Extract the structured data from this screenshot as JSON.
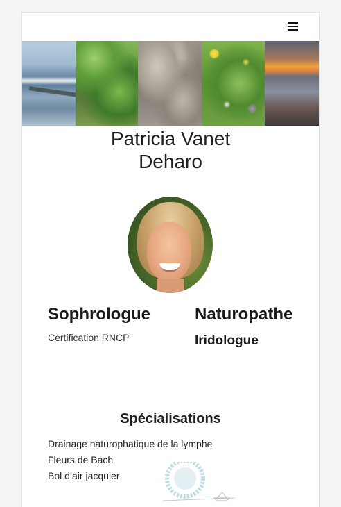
{
  "header": {
    "menu_icon": "hamburger-menu-icon"
  },
  "banner": {
    "tiles": [
      "sea-waves",
      "forest-stream",
      "rocks",
      "wildflowers",
      "sunset-beach"
    ]
  },
  "profile": {
    "name_line1": "Patricia Vanet",
    "name_line2": "Deharo",
    "photo": "portrait-photo"
  },
  "roles": {
    "left": {
      "title": "Sophrologue",
      "note": "Certification RNCP"
    },
    "right": {
      "title": "Naturopathe",
      "subtitle": "Iridologue"
    }
  },
  "specialisations": {
    "title": "Spécialisations",
    "items": [
      "Drainage naturophatique de la lymphe",
      "Fleurs de Bach",
      "Bol d’air jacquier"
    ]
  },
  "colors": {
    "background": "#f4f4f4",
    "card": "#ffffff",
    "text": "#222222",
    "watermark": "#7fb3c2"
  }
}
